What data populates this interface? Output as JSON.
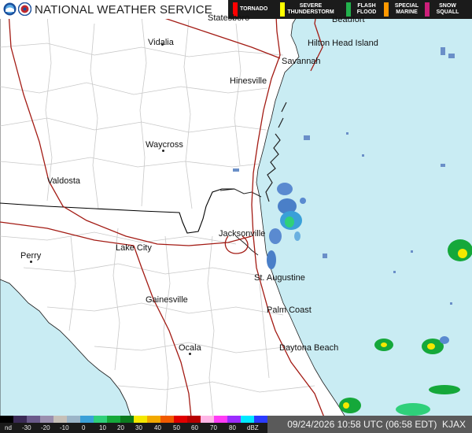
{
  "header": {
    "title": "NATIONAL WEATHER SERVICE"
  },
  "warnings_legend": [
    {
      "label": "TORNADO",
      "color": "#ff0000"
    },
    {
      "label": "SEVERE THUNDERSTORM",
      "color": "#ffff00"
    },
    {
      "label": "FLASH FLOOD",
      "color": "#22b14c"
    },
    {
      "label": "SPECIAL MARINE",
      "color": "#ff9900"
    },
    {
      "label": "SNOW SQUALL",
      "color": "#cc1f7a"
    }
  ],
  "map": {
    "land_color": "#ffffff",
    "water_color": "#c9ecf3",
    "county_line_color": "#c8c8c8",
    "state_line_color": "#000000",
    "highway_color": "#a31b14",
    "cities": [
      {
        "name": "Statesboro"
      },
      {
        "name": "Beaufort"
      },
      {
        "name": "Vidalia"
      },
      {
        "name": "Hilton Head Island"
      },
      {
        "name": "Savannah"
      },
      {
        "name": "Hinesville"
      },
      {
        "name": "Waycross"
      },
      {
        "name": "Valdosta"
      },
      {
        "name": "Jacksonville"
      },
      {
        "name": "Perry"
      },
      {
        "name": "Lake City"
      },
      {
        "name": "St. Augustine"
      },
      {
        "name": "Gainesville"
      },
      {
        "name": "Palm Coast"
      },
      {
        "name": "Ocala"
      },
      {
        "name": "Daytona Beach"
      }
    ]
  },
  "dbz_scale": {
    "ticks": [
      "nd",
      "-30",
      "-20",
      "-10",
      "0",
      "10",
      "20",
      "30",
      "40",
      "50",
      "60",
      "70",
      "80",
      "dBZ"
    ],
    "colors": [
      "#000000",
      "#3a2a55",
      "#6a5a8a",
      "#9a8fae",
      "#c6c0b8",
      "#9bb5c8",
      "#3aa0d8",
      "#2fd07a",
      "#15a83a",
      "#0b7a1e",
      "#f4e800",
      "#f2a900",
      "#f05a00",
      "#e00000",
      "#b80000",
      "#ffb6e6",
      "#ff3cf5",
      "#9b2cff",
      "#00e8ff",
      "#2b3bff"
    ]
  },
  "status": {
    "timestamp": "09/24/2026 10:58 UTC (06:58 EDT)",
    "station": "KJAX"
  }
}
